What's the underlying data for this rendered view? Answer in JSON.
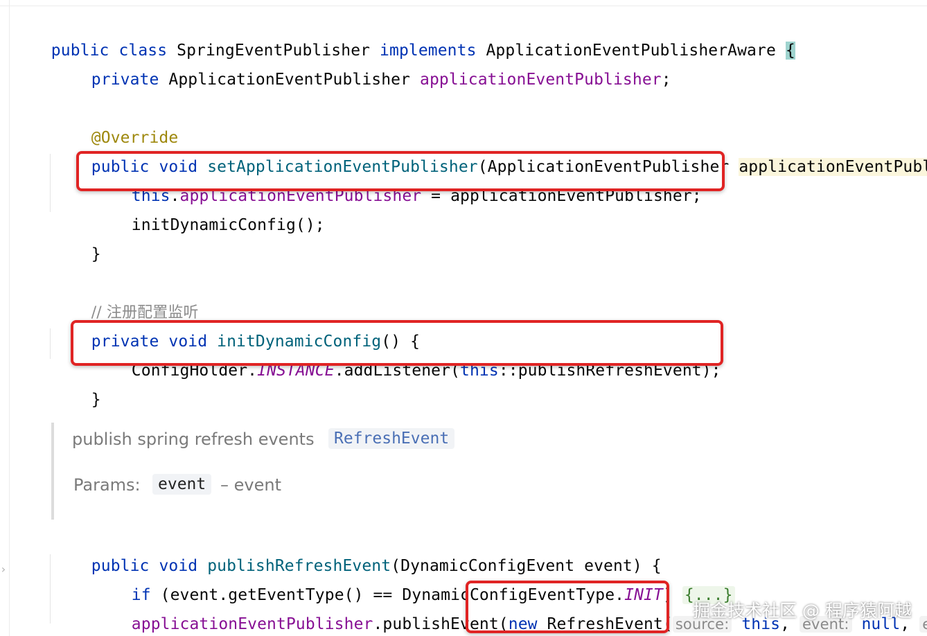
{
  "code": {
    "l1": {
      "kw1": "public",
      "kw2": "class",
      "name": "SpringEventPublisher",
      "kw3": "implements",
      "iface": "ApplicationEventPublisherAware",
      "brace": "{"
    },
    "l2": {
      "kw": "private",
      "type": "ApplicationEventPublisher",
      "field": "applicationEventPublisher",
      "end": ";"
    },
    "l3": {
      "annotation": "@Override"
    },
    "l4": {
      "kw1": "public",
      "kw2": "void",
      "method": "setApplicationEventPublisher",
      "open": "(ApplicationEventPublisher",
      "param": "applicationEventPubli"
    },
    "l5": {
      "kw": "this",
      "dot": ".",
      "field": "applicationEventPublisher",
      "rest": " = applicationEventPublisher;"
    },
    "l6": {
      "text": "initDynamicConfig();"
    },
    "l7": {
      "text": "}"
    },
    "l8": {
      "comment": "// 注册配置监听"
    },
    "l9": {
      "kw1": "private",
      "kw2": "void",
      "method": "initDynamicConfig",
      "rest": "() {"
    },
    "l10": {
      "a": "ConfigHolder.",
      "b": "INSTANCE",
      "c": ".addListener(",
      "d": "this",
      "e": "::publishRefreshEvent);"
    },
    "l11": {
      "text": "}"
    },
    "l12": {
      "kw1": "public",
      "kw2": "void",
      "method": "publishRefreshEvent",
      "rest": "(DynamicConfigEvent event) {"
    },
    "l13": {
      "kw": "if",
      "a": " (event.getEventType() == DynamicConfigEventType.",
      "b": "INIT",
      "c": ") ",
      "fold": "{...}"
    },
    "l14": {
      "field": "applicationEventPublisher",
      "a": ".publishEvent(",
      "kw": "new",
      "b": " RefreshEvent(",
      "hint1": "source:",
      "kw2": "this",
      "c": ",",
      "hint2": "event:",
      "kw3": "null",
      "d": ",",
      "hint3": "ev"
    },
    "l15": {
      "text": "}"
    }
  },
  "doc": {
    "summary": "publish spring refresh events",
    "link": "RefreshEvent",
    "params_label": "Params:",
    "param_name": "event",
    "param_desc": "– event"
  },
  "watermark": "掘金技术社区 @ 程序猿阿越"
}
